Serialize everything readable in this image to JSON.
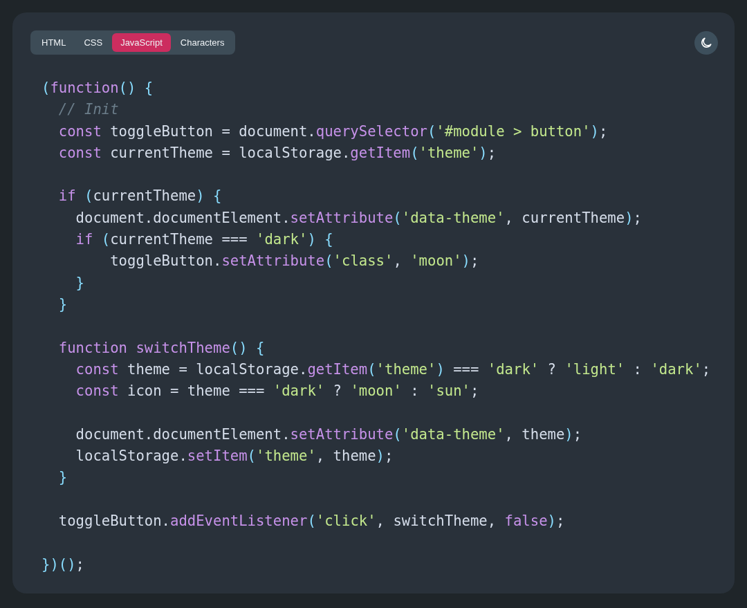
{
  "tabs": [
    {
      "label": "HTML",
      "selected": false
    },
    {
      "label": "CSS",
      "selected": false
    },
    {
      "label": "JavaScript",
      "selected": true
    },
    {
      "label": "Characters",
      "selected": false
    }
  ],
  "code_lines": [
    {
      "kind": "code",
      "tokens": [
        {
          "kind": "pun",
          "text": "("
        },
        {
          "kind": "kw",
          "text": "function"
        },
        {
          "kind": "pun",
          "text": "() {"
        }
      ]
    },
    {
      "kind": "code",
      "tokens": [
        {
          "kind": "cm",
          "text": "  // Init"
        }
      ]
    },
    {
      "kind": "code",
      "tokens": [
        {
          "kind": "kw",
          "text": "  const"
        },
        {
          "kind": "tx",
          "text": " toggleButton = document."
        },
        {
          "kind": "fn",
          "text": "querySelector"
        },
        {
          "kind": "pun",
          "text": "("
        },
        {
          "kind": "str",
          "text": "'#module > button'"
        },
        {
          "kind": "pun",
          "text": ")"
        },
        {
          "kind": "tx",
          "text": ";"
        }
      ]
    },
    {
      "kind": "code",
      "tokens": [
        {
          "kind": "kw",
          "text": "  const"
        },
        {
          "kind": "tx",
          "text": " currentTheme = localStorage."
        },
        {
          "kind": "fn",
          "text": "getItem"
        },
        {
          "kind": "pun",
          "text": "("
        },
        {
          "kind": "str",
          "text": "'theme'"
        },
        {
          "kind": "pun",
          "text": ")"
        },
        {
          "kind": "tx",
          "text": ";"
        }
      ]
    },
    {
      "kind": "blank"
    },
    {
      "kind": "code",
      "tokens": [
        {
          "kind": "kw",
          "text": "  if"
        },
        {
          "kind": "pun",
          "text": " ("
        },
        {
          "kind": "tx",
          "text": "currentTheme"
        },
        {
          "kind": "pun",
          "text": ") {"
        }
      ]
    },
    {
      "kind": "code",
      "tokens": [
        {
          "kind": "tx",
          "text": "    document.documentElement."
        },
        {
          "kind": "fn",
          "text": "setAttribute"
        },
        {
          "kind": "pun",
          "text": "("
        },
        {
          "kind": "str",
          "text": "'data-theme'"
        },
        {
          "kind": "tx",
          "text": ", currentTheme"
        },
        {
          "kind": "pun",
          "text": ")"
        },
        {
          "kind": "tx",
          "text": ";"
        }
      ]
    },
    {
      "kind": "code",
      "tokens": [
        {
          "kind": "kw",
          "text": "    if"
        },
        {
          "kind": "pun",
          "text": " ("
        },
        {
          "kind": "tx",
          "text": "currentTheme === "
        },
        {
          "kind": "str",
          "text": "'dark'"
        },
        {
          "kind": "pun",
          "text": ") {"
        }
      ]
    },
    {
      "kind": "code",
      "tokens": [
        {
          "kind": "tx",
          "text": "        toggleButton."
        },
        {
          "kind": "fn",
          "text": "setAttribute"
        },
        {
          "kind": "pun",
          "text": "("
        },
        {
          "kind": "str",
          "text": "'class'"
        },
        {
          "kind": "tx",
          "text": ", "
        },
        {
          "kind": "str",
          "text": "'moon'"
        },
        {
          "kind": "pun",
          "text": ")"
        },
        {
          "kind": "tx",
          "text": ";"
        }
      ]
    },
    {
      "kind": "code",
      "tokens": [
        {
          "kind": "pun",
          "text": "    }"
        }
      ]
    },
    {
      "kind": "code",
      "tokens": [
        {
          "kind": "pun",
          "text": "  }"
        }
      ]
    },
    {
      "kind": "blank"
    },
    {
      "kind": "code",
      "tokens": [
        {
          "kind": "kw",
          "text": "  function"
        },
        {
          "kind": "fn",
          "text": " switchTheme"
        },
        {
          "kind": "pun",
          "text": "() {"
        }
      ]
    },
    {
      "kind": "code",
      "tokens": [
        {
          "kind": "kw",
          "text": "    const"
        },
        {
          "kind": "tx",
          "text": " theme = localStorage."
        },
        {
          "kind": "fn",
          "text": "getItem"
        },
        {
          "kind": "pun",
          "text": "("
        },
        {
          "kind": "str",
          "text": "'theme'"
        },
        {
          "kind": "pun",
          "text": ")"
        },
        {
          "kind": "tx",
          "text": " === "
        },
        {
          "kind": "str",
          "text": "'dark'"
        },
        {
          "kind": "tx",
          "text": " ? "
        },
        {
          "kind": "str",
          "text": "'light'"
        },
        {
          "kind": "tx",
          "text": " : "
        },
        {
          "kind": "str",
          "text": "'dark'"
        },
        {
          "kind": "tx",
          "text": ";"
        }
      ]
    },
    {
      "kind": "code",
      "tokens": [
        {
          "kind": "kw",
          "text": "    const"
        },
        {
          "kind": "tx",
          "text": " icon = theme === "
        },
        {
          "kind": "str",
          "text": "'dark'"
        },
        {
          "kind": "tx",
          "text": " ? "
        },
        {
          "kind": "str",
          "text": "'moon'"
        },
        {
          "kind": "tx",
          "text": " : "
        },
        {
          "kind": "str",
          "text": "'sun'"
        },
        {
          "kind": "tx",
          "text": ";"
        }
      ]
    },
    {
      "kind": "blank"
    },
    {
      "kind": "code",
      "tokens": [
        {
          "kind": "tx",
          "text": "    document.documentElement."
        },
        {
          "kind": "fn",
          "text": "setAttribute"
        },
        {
          "kind": "pun",
          "text": "("
        },
        {
          "kind": "str",
          "text": "'data-theme'"
        },
        {
          "kind": "tx",
          "text": ", theme"
        },
        {
          "kind": "pun",
          "text": ")"
        },
        {
          "kind": "tx",
          "text": ";"
        }
      ]
    },
    {
      "kind": "code",
      "tokens": [
        {
          "kind": "tx",
          "text": "    localStorage."
        },
        {
          "kind": "fn",
          "text": "setItem"
        },
        {
          "kind": "pun",
          "text": "("
        },
        {
          "kind": "str",
          "text": "'theme'"
        },
        {
          "kind": "tx",
          "text": ", theme"
        },
        {
          "kind": "pun",
          "text": ")"
        },
        {
          "kind": "tx",
          "text": ";"
        }
      ]
    },
    {
      "kind": "code",
      "tokens": [
        {
          "kind": "pun",
          "text": "  }"
        }
      ]
    },
    {
      "kind": "blank"
    },
    {
      "kind": "code",
      "tokens": [
        {
          "kind": "tx",
          "text": "  toggleButton."
        },
        {
          "kind": "fn",
          "text": "addEventListener"
        },
        {
          "kind": "pun",
          "text": "("
        },
        {
          "kind": "str",
          "text": "'click'"
        },
        {
          "kind": "tx",
          "text": ", switchTheme, "
        },
        {
          "kind": "kw",
          "text": "false"
        },
        {
          "kind": "pun",
          "text": ")"
        },
        {
          "kind": "tx",
          "text": ";"
        }
      ]
    },
    {
      "kind": "blank"
    },
    {
      "kind": "code",
      "tokens": [
        {
          "kind": "pun",
          "text": "})()"
        },
        {
          "kind": "tx",
          "text": ";"
        }
      ]
    }
  ]
}
